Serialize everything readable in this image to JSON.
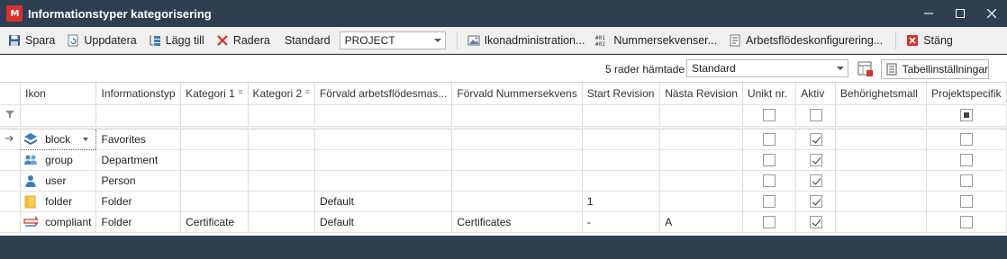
{
  "window": {
    "title": "Informationstyper kategorisering",
    "logo_text": "M"
  },
  "toolbar": {
    "save": "Spara",
    "refresh": "Uppdatera",
    "add": "Lägg till",
    "delete": "Radera",
    "standard_label": "Standard",
    "project_value": "PROJECT",
    "icon_admin": "Ikonadministration...",
    "number_sequences": "Nummersekvenser...",
    "workflow_config": "Arbetsflödeskonfigurering...",
    "close": "Stäng"
  },
  "subbar": {
    "rows_fetched": "5 rader hämtade",
    "view_value": "Standard",
    "table_settings": "Tabellinställningar"
  },
  "columns": [
    "Ikon",
    "Informationstyp",
    "Kategori 1",
    "Kategori 2",
    "Förvald arbetsflödesmas...",
    "Förvald Nummersekvens",
    "Start Revision",
    "Nästa Revision",
    "Unikt nr.",
    "Aktiv",
    "Behörighetsmall",
    "Projektspecifik"
  ],
  "rows": [
    {
      "icon": "block",
      "icon_name": "stack-icon",
      "type": "Favorites",
      "cat1": "",
      "cat2": "",
      "workflow": "",
      "numseq": "",
      "start_rev": "",
      "next_rev": "",
      "unique": false,
      "active": true,
      "perm": "",
      "projspec": false
    },
    {
      "icon": "group",
      "icon_name": "group-icon",
      "type": "Department",
      "cat1": "",
      "cat2": "",
      "workflow": "",
      "numseq": "",
      "start_rev": "",
      "next_rev": "",
      "unique": false,
      "active": true,
      "perm": "",
      "projspec": false
    },
    {
      "icon": "user",
      "icon_name": "user-icon",
      "type": "Person",
      "cat1": "",
      "cat2": "",
      "workflow": "",
      "numseq": "",
      "start_rev": "",
      "next_rev": "",
      "unique": false,
      "active": true,
      "perm": "",
      "projspec": false
    },
    {
      "icon": "folder",
      "icon_name": "folder-icon",
      "type": "Folder",
      "cat1": "",
      "cat2": "",
      "workflow": "Default",
      "numseq": "",
      "start_rev": "1",
      "next_rev": "",
      "unique": false,
      "active": true,
      "perm": "",
      "projspec": false
    },
    {
      "icon": "compliant",
      "icon_name": "compliant-icon",
      "type": "Folder",
      "cat1": "Certificate",
      "cat2": "",
      "workflow": "Default",
      "numseq": "Certificates",
      "start_rev": "-",
      "next_rev": "A",
      "unique": false,
      "active": true,
      "perm": "",
      "projspec": false
    }
  ],
  "colors": {
    "titlebar": "#2e3f51",
    "toolbar": "#f0f0f0",
    "accent_blue": "#3b7dc4",
    "delete_red": "#d9312b"
  }
}
